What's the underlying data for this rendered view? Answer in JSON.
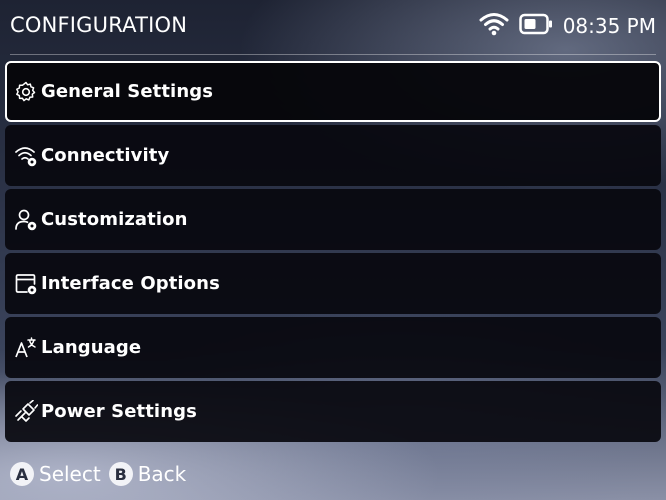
{
  "header": {
    "title": "CONFIGURATION",
    "time": "08:35 PM",
    "icons": [
      "wifi-icon",
      "battery-icon"
    ]
  },
  "menu": {
    "items": [
      {
        "label": "General Settings",
        "icon": "gear-icon",
        "selected": true
      },
      {
        "label": "Connectivity",
        "icon": "wifi-settings-icon",
        "selected": false
      },
      {
        "label": "Customization",
        "icon": "user-settings-icon",
        "selected": false
      },
      {
        "label": "Interface Options",
        "icon": "window-settings-icon",
        "selected": false
      },
      {
        "label": "Language",
        "icon": "translate-icon",
        "selected": false
      },
      {
        "label": "Power Settings",
        "icon": "plug-icon",
        "selected": false
      }
    ]
  },
  "footer": {
    "a_glyph": "A",
    "a_label": "Select",
    "b_glyph": "B",
    "b_label": "Back"
  },
  "colors": {
    "item_background": "#08080e",
    "selected_border": "#ffffff",
    "text": "#ffffff"
  }
}
